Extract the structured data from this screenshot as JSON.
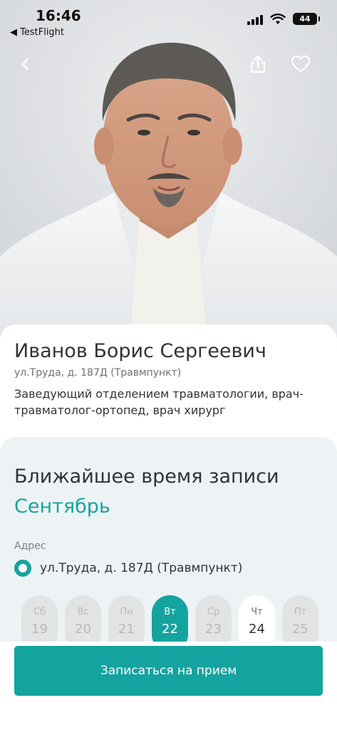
{
  "status_bar": {
    "time": "16:46",
    "back_app": "◀ TestFlight",
    "battery": "44"
  },
  "header": {
    "back_icon": "chevron-left-icon",
    "share_icon": "share-icon",
    "favorite_icon": "heart-outline-icon"
  },
  "doctor": {
    "name": "Иванов Борис Сергеевич",
    "address": "ул.Труда, д. 187Д (Травмпункт)",
    "position": "Заведующий отделением травматологии, врач-травматолог-ортопед, врач хирург"
  },
  "schedule": {
    "title": "Ближайшее время записи",
    "month": "Сентябрь",
    "address_label": "Адрес",
    "address_value": "ул.Труда, д. 187Д (Травмпункт)",
    "days": [
      {
        "dow": "Сб",
        "num": "19",
        "state": "disabled"
      },
      {
        "dow": "Вс",
        "num": "20",
        "state": "disabled"
      },
      {
        "dow": "Пн",
        "num": "21",
        "state": "disabled"
      },
      {
        "dow": "Вт",
        "num": "22",
        "state": "selected"
      },
      {
        "dow": "Ср",
        "num": "23",
        "state": "disabled"
      },
      {
        "dow": "Чт",
        "num": "24",
        "state": "available"
      },
      {
        "dow": "Пт",
        "num": "25",
        "state": "disabled"
      }
    ]
  },
  "actions": {
    "book_label": "Записаться на прием"
  },
  "colors": {
    "accent": "#15a3a0",
    "text": "#2f3338",
    "muted": "#6b7075",
    "panel": "#edf3f4"
  }
}
